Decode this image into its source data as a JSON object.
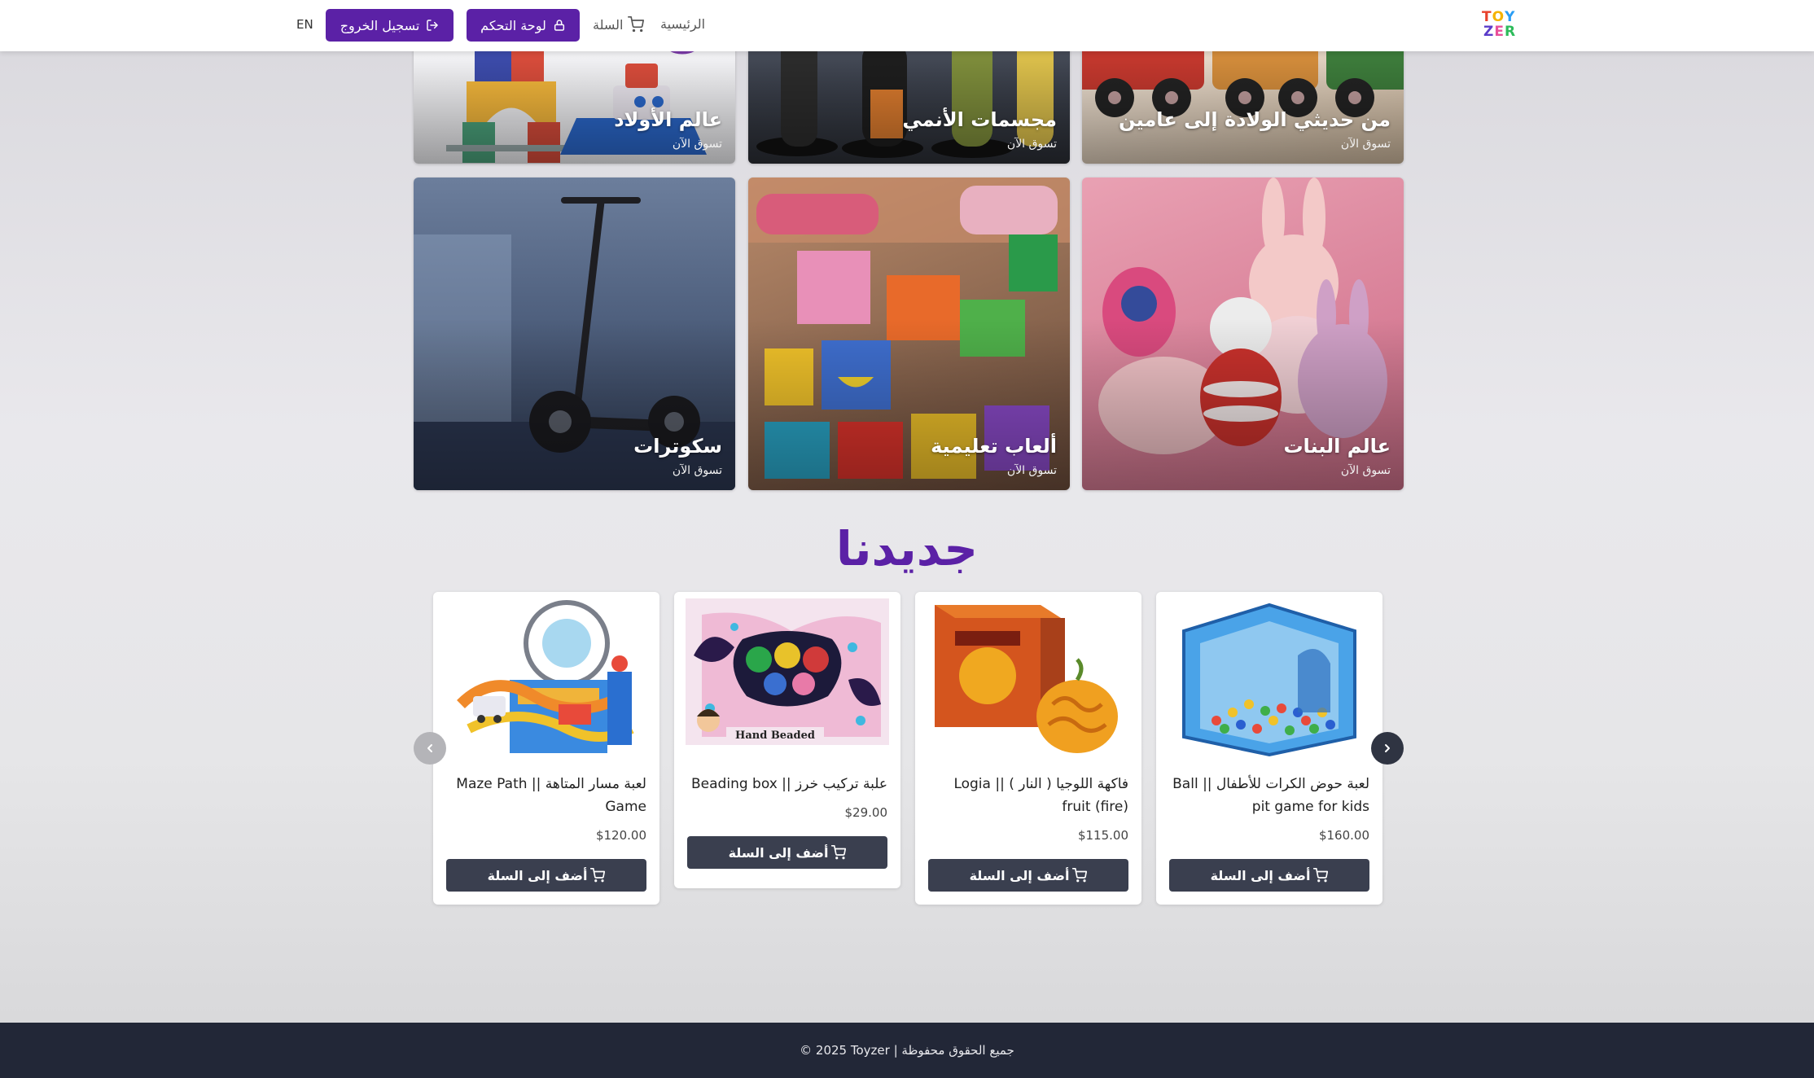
{
  "header": {
    "logo": {
      "line1": [
        "T",
        "O",
        "Y"
      ],
      "line2": [
        "Z",
        "E",
        "R"
      ],
      "colors": [
        "#e8412c",
        "#f5b200",
        "#2a9df4",
        "#5a3cc9",
        "#e84f9b",
        "#2dbb5a"
      ]
    },
    "nav": {
      "home": "الرئيسية",
      "cart": "السلة"
    },
    "dashboard_label": "لوحة التحكم",
    "logout_label": "تسجيل الخروج",
    "lang": "EN",
    "accent": "#5b21a6"
  },
  "categories": [
    {
      "title": "من حديثي الولادة إلى عامين",
      "sub": "تسوق الآن"
    },
    {
      "title": "مجسمات الأنمي",
      "sub": "تسوق الآن"
    },
    {
      "title": "عالم الأولاد",
      "sub": "تسوق الآن"
    },
    {
      "title": "عالم البنات",
      "sub": "تسوق الآن"
    },
    {
      "title": "ألعاب تعليمية",
      "sub": "تسوق الآن"
    },
    {
      "title": "سكوترات",
      "sub": "تسوق الآن"
    }
  ],
  "new_section": {
    "title": "جديدنا"
  },
  "products": [
    {
      "name": "لعبة حوض الكرات للأطفال || Ball pit game for kids",
      "price": "$160.00",
      "add_label": "أضف إلى السلة"
    },
    {
      "name": "فاكهة اللوجيا ( النار ) || Logia fruit (fire)",
      "price": "$115.00",
      "add_label": "أضف إلى السلة"
    },
    {
      "name": "علبة تركيب خرز || Beading box",
      "price": "$29.00",
      "add_label": "أضف إلى السلة"
    },
    {
      "name": "لعبة مسار المتاهة || Maze Path Game",
      "price": "$120.00",
      "add_label": "أضف إلى السلة"
    }
  ],
  "image_text": {
    "hand_beaded": "Hand Beaded"
  },
  "footer": {
    "text": "© 2025 Toyzer | جميع الحقوق محفوظة"
  }
}
